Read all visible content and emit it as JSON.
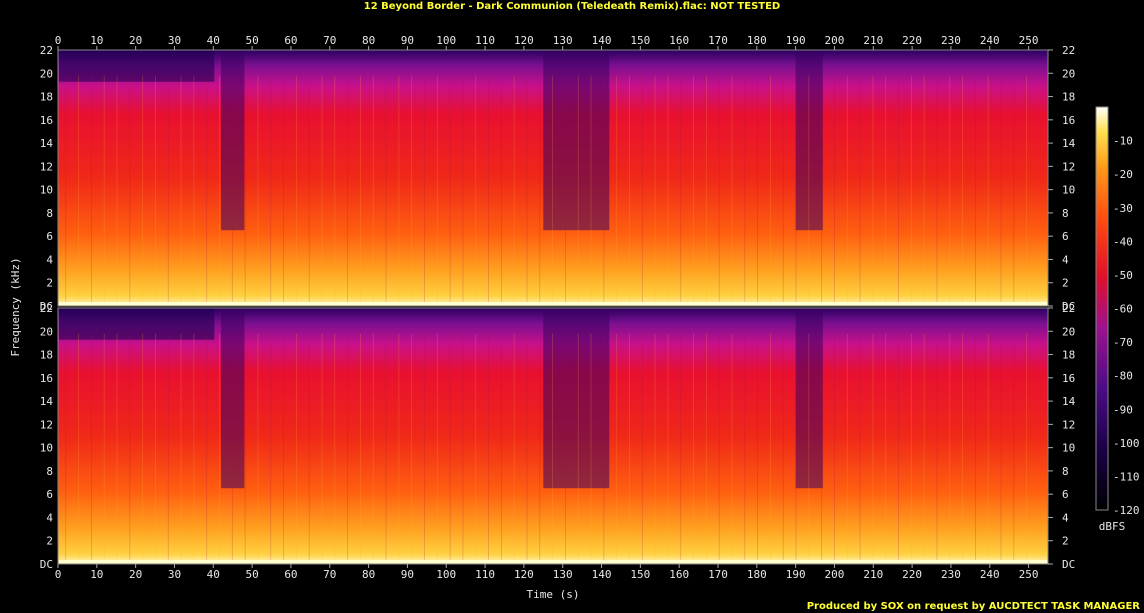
{
  "title": "12 Beyond Border - Dark Communion (Teledeath Remix).flac: NOT TESTED",
  "footer": "Produced by SOX on request by AUCDTECT TASK MANAGER",
  "chart_data": {
    "type": "heatmap",
    "xlabel": "Time (s)",
    "ylabel": "Frequency (kHz)",
    "colorbar_label": "dBFS",
    "x_ticks": [
      "0",
      "10",
      "20",
      "30",
      "40",
      "50",
      "60",
      "70",
      "80",
      "90",
      "100",
      "110",
      "120",
      "130",
      "140",
      "150",
      "160",
      "170",
      "180",
      "190",
      "200",
      "210",
      "220",
      "230",
      "240",
      "250"
    ],
    "xlim": [
      0,
      255
    ],
    "y_ticks": [
      "DC",
      "2",
      "4",
      "6",
      "8",
      "10",
      "12",
      "14",
      "16",
      "18",
      "20",
      "22"
    ],
    "ylim_khz": [
      0,
      22
    ],
    "colorbar_ticks": [
      "-10",
      "-20",
      "-30",
      "-40",
      "-50",
      "-60",
      "-70",
      "-80",
      "-90",
      "-100",
      "-110",
      "-120"
    ],
    "colorbar_range_dbfs": [
      -120,
      0
    ],
    "channels": 2,
    "colormap": [
      "#000000",
      "#200050",
      "#5a0d8a",
      "#a0128a",
      "#e0102a",
      "#ff4010",
      "#ff9010",
      "#ffd040",
      "#ffffff"
    ],
    "notes": "Spectrogram for two channels; energy extends to ~21 kHz across nearly the whole track; darker sections near 42-48 s, 125-142 s and 190-197 s."
  }
}
